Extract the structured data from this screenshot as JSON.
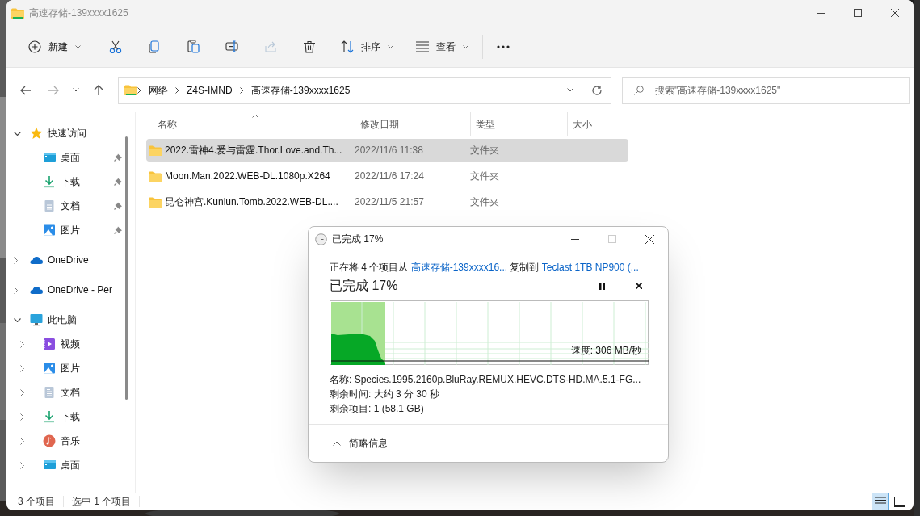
{
  "window": {
    "title": "高速存储-139xxxx1625"
  },
  "toolbar": [
    {
      "kind": "new",
      "label": "新建",
      "disabled": false
    },
    {
      "kind": "cut",
      "disabled": false
    },
    {
      "kind": "copy",
      "disabled": false
    },
    {
      "kind": "paste",
      "disabled": false
    },
    {
      "kind": "rename",
      "disabled": false
    },
    {
      "kind": "share",
      "disabled": true
    },
    {
      "kind": "delete",
      "disabled": false
    },
    {
      "kind": "sort",
      "label": "排序",
      "disabled": false
    },
    {
      "kind": "view",
      "label": "查看",
      "disabled": false
    },
    {
      "kind": "more",
      "disabled": false
    }
  ],
  "address": {
    "breadcrumbs": [
      "网络",
      "Z4S-IMND",
      "高速存储-139xxxx1625"
    ]
  },
  "search": {
    "placeholder": "搜索\"高速存储-139xxxx1625\""
  },
  "sidebar": {
    "items": [
      {
        "label": "快速访问",
        "kind": "star",
        "expanded": true,
        "children": [
          {
            "label": "桌面",
            "kind": "desktop",
            "pinned": true
          },
          {
            "label": "下载",
            "kind": "download",
            "pinned": true
          },
          {
            "label": "文档",
            "kind": "document",
            "pinned": true
          },
          {
            "label": "图片",
            "kind": "pictures",
            "pinned": true
          }
        ]
      },
      {
        "label": "OneDrive",
        "kind": "cloud",
        "expanded": false
      },
      {
        "label": "OneDrive - Per",
        "kind": "cloud",
        "expanded": false
      },
      {
        "label": "此电脑",
        "kind": "monitor",
        "expanded": true,
        "children": [
          {
            "label": "视频",
            "kind": "video",
            "expanded": false
          },
          {
            "label": "图片",
            "kind": "pictures",
            "expanded": false
          },
          {
            "label": "文档",
            "kind": "document",
            "expanded": false
          },
          {
            "label": "下载",
            "kind": "download",
            "expanded": false
          },
          {
            "label": "音乐",
            "kind": "music",
            "expanded": false
          },
          {
            "label": "桌面",
            "kind": "desktop",
            "expanded": false
          }
        ]
      }
    ]
  },
  "file_list": {
    "columns": [
      "名称",
      "修改日期",
      "类型",
      "大小"
    ],
    "rows": [
      {
        "name": "2022.雷神4.爱与雷霆.Thor.Love.and.Th...",
        "modified": "2022/11/6 11:38",
        "type": "文件夹",
        "selected": true
      },
      {
        "name": "Moon.Man.2022.WEB-DL.1080p.X264",
        "modified": "2022/11/6 17:24",
        "type": "文件夹",
        "selected": false
      },
      {
        "name": "昆仑神宫.Kunlun.Tomb.2022.WEB-DL....",
        "modified": "2022/11/5 21:57",
        "type": "文件夹",
        "selected": false
      }
    ]
  },
  "status_bar": {
    "item_count": "3 个项目",
    "selection": "选中 1 个项目",
    "views": [
      {
        "kind": "details",
        "selected": true
      },
      {
        "kind": "tiles",
        "selected": false
      }
    ]
  },
  "copy_dialog": {
    "title": "已完成 17%",
    "description": [
      {
        "kind": "text",
        "text": "正在将 4 个项目从 "
      },
      {
        "kind": "link",
        "text": "高速存储-139xxxx16..."
      },
      {
        "kind": "text",
        "text": " 复制到 "
      },
      {
        "kind": "link",
        "text": "Teclast 1TB NP900 (..."
      }
    ],
    "heading": "已完成 17%",
    "progress": {
      "level": 0.17
    },
    "speed": "速度: 306 MB/秒",
    "details": [
      "名称: Species.1995.2160p.BluRay.REMUX.HEVC.DTS-HD.MA.5.1-FG...",
      "剩余时间: 大约 3 分 30 秒",
      "剩余项目: 1 (58.1 GB)"
    ],
    "footer": "简略信息"
  }
}
